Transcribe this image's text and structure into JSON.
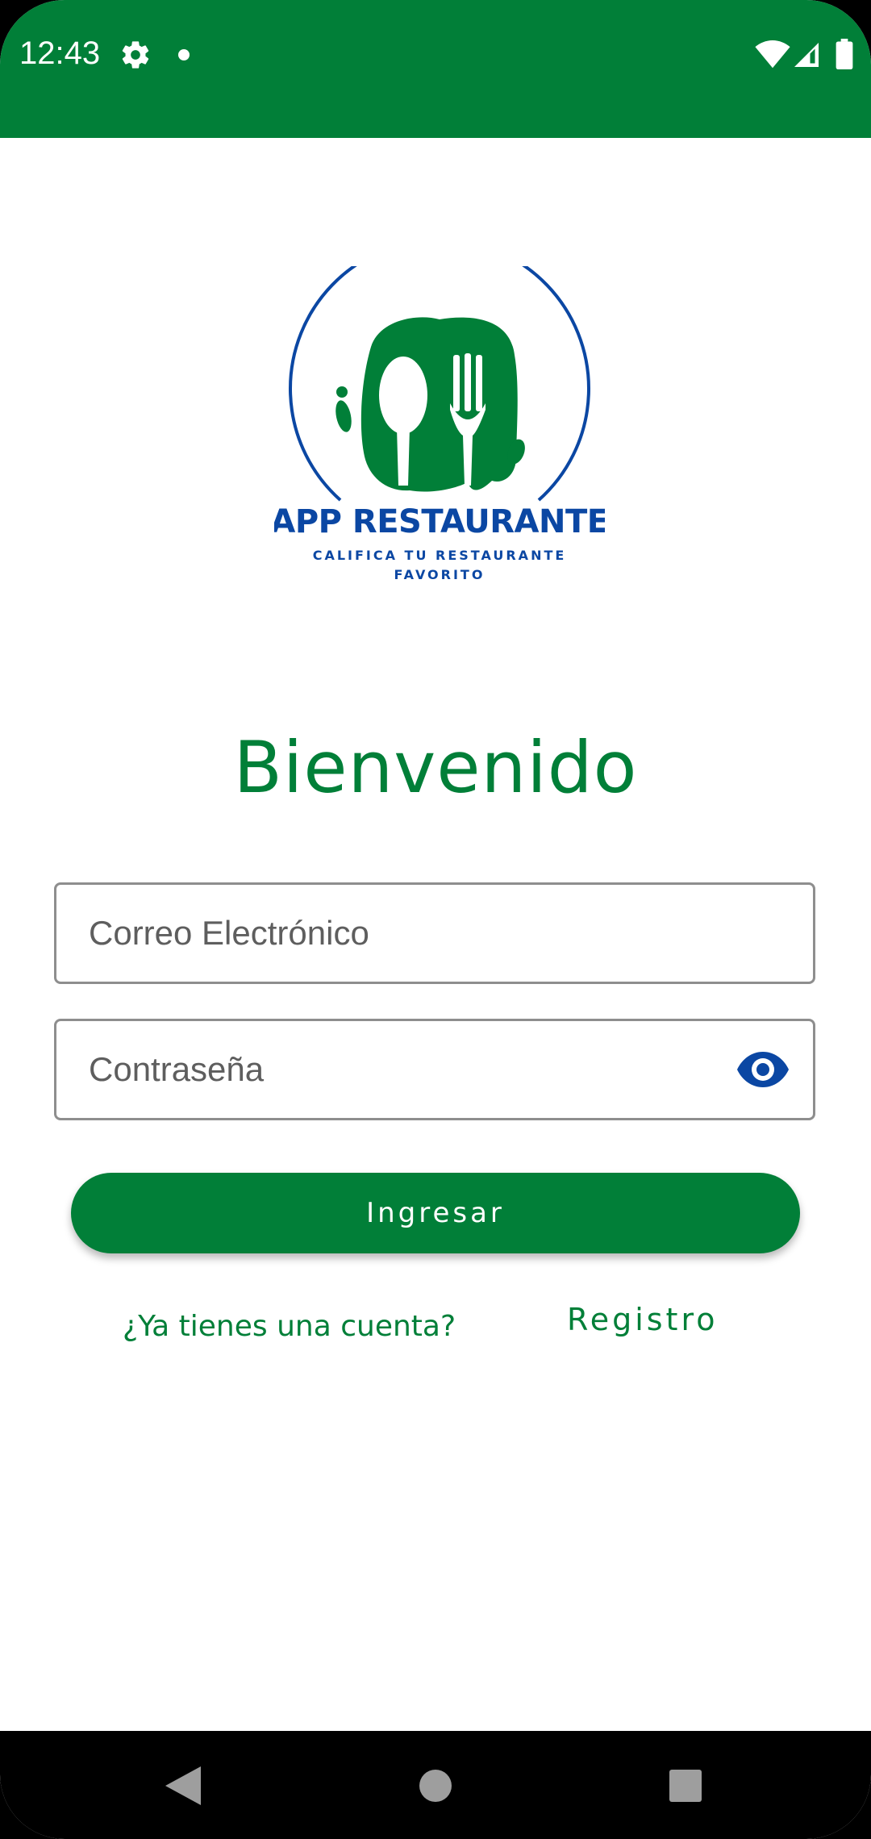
{
  "status_bar": {
    "time": "12:43",
    "icons": [
      "gear-icon",
      "notification-dot-icon",
      "wifi-icon",
      "cell-signal-icon",
      "battery-icon"
    ],
    "color": "#017f38"
  },
  "logo": {
    "title": "APP RESTAURANTE",
    "subtitle_line1": "CALIFICA TU RESTAURANTE",
    "subtitle_line2": "FAVORITO",
    "green": "#017f38",
    "blue": "#0b47a3"
  },
  "heading": "Bienvenido",
  "form": {
    "email": {
      "placeholder": "Correo Electrónico",
      "value": ""
    },
    "password": {
      "placeholder": "Contraseña",
      "value": "",
      "toggle_icon": "eye-icon"
    },
    "submit_label": "Ingresar"
  },
  "footer": {
    "prompt": "¿Ya tienes una cuenta?",
    "register_label": "Registro"
  },
  "nav": {
    "icons": [
      "back-icon",
      "home-icon",
      "recents-icon"
    ]
  },
  "colors": {
    "primary": "#017f38",
    "accent": "#0b47a3"
  }
}
